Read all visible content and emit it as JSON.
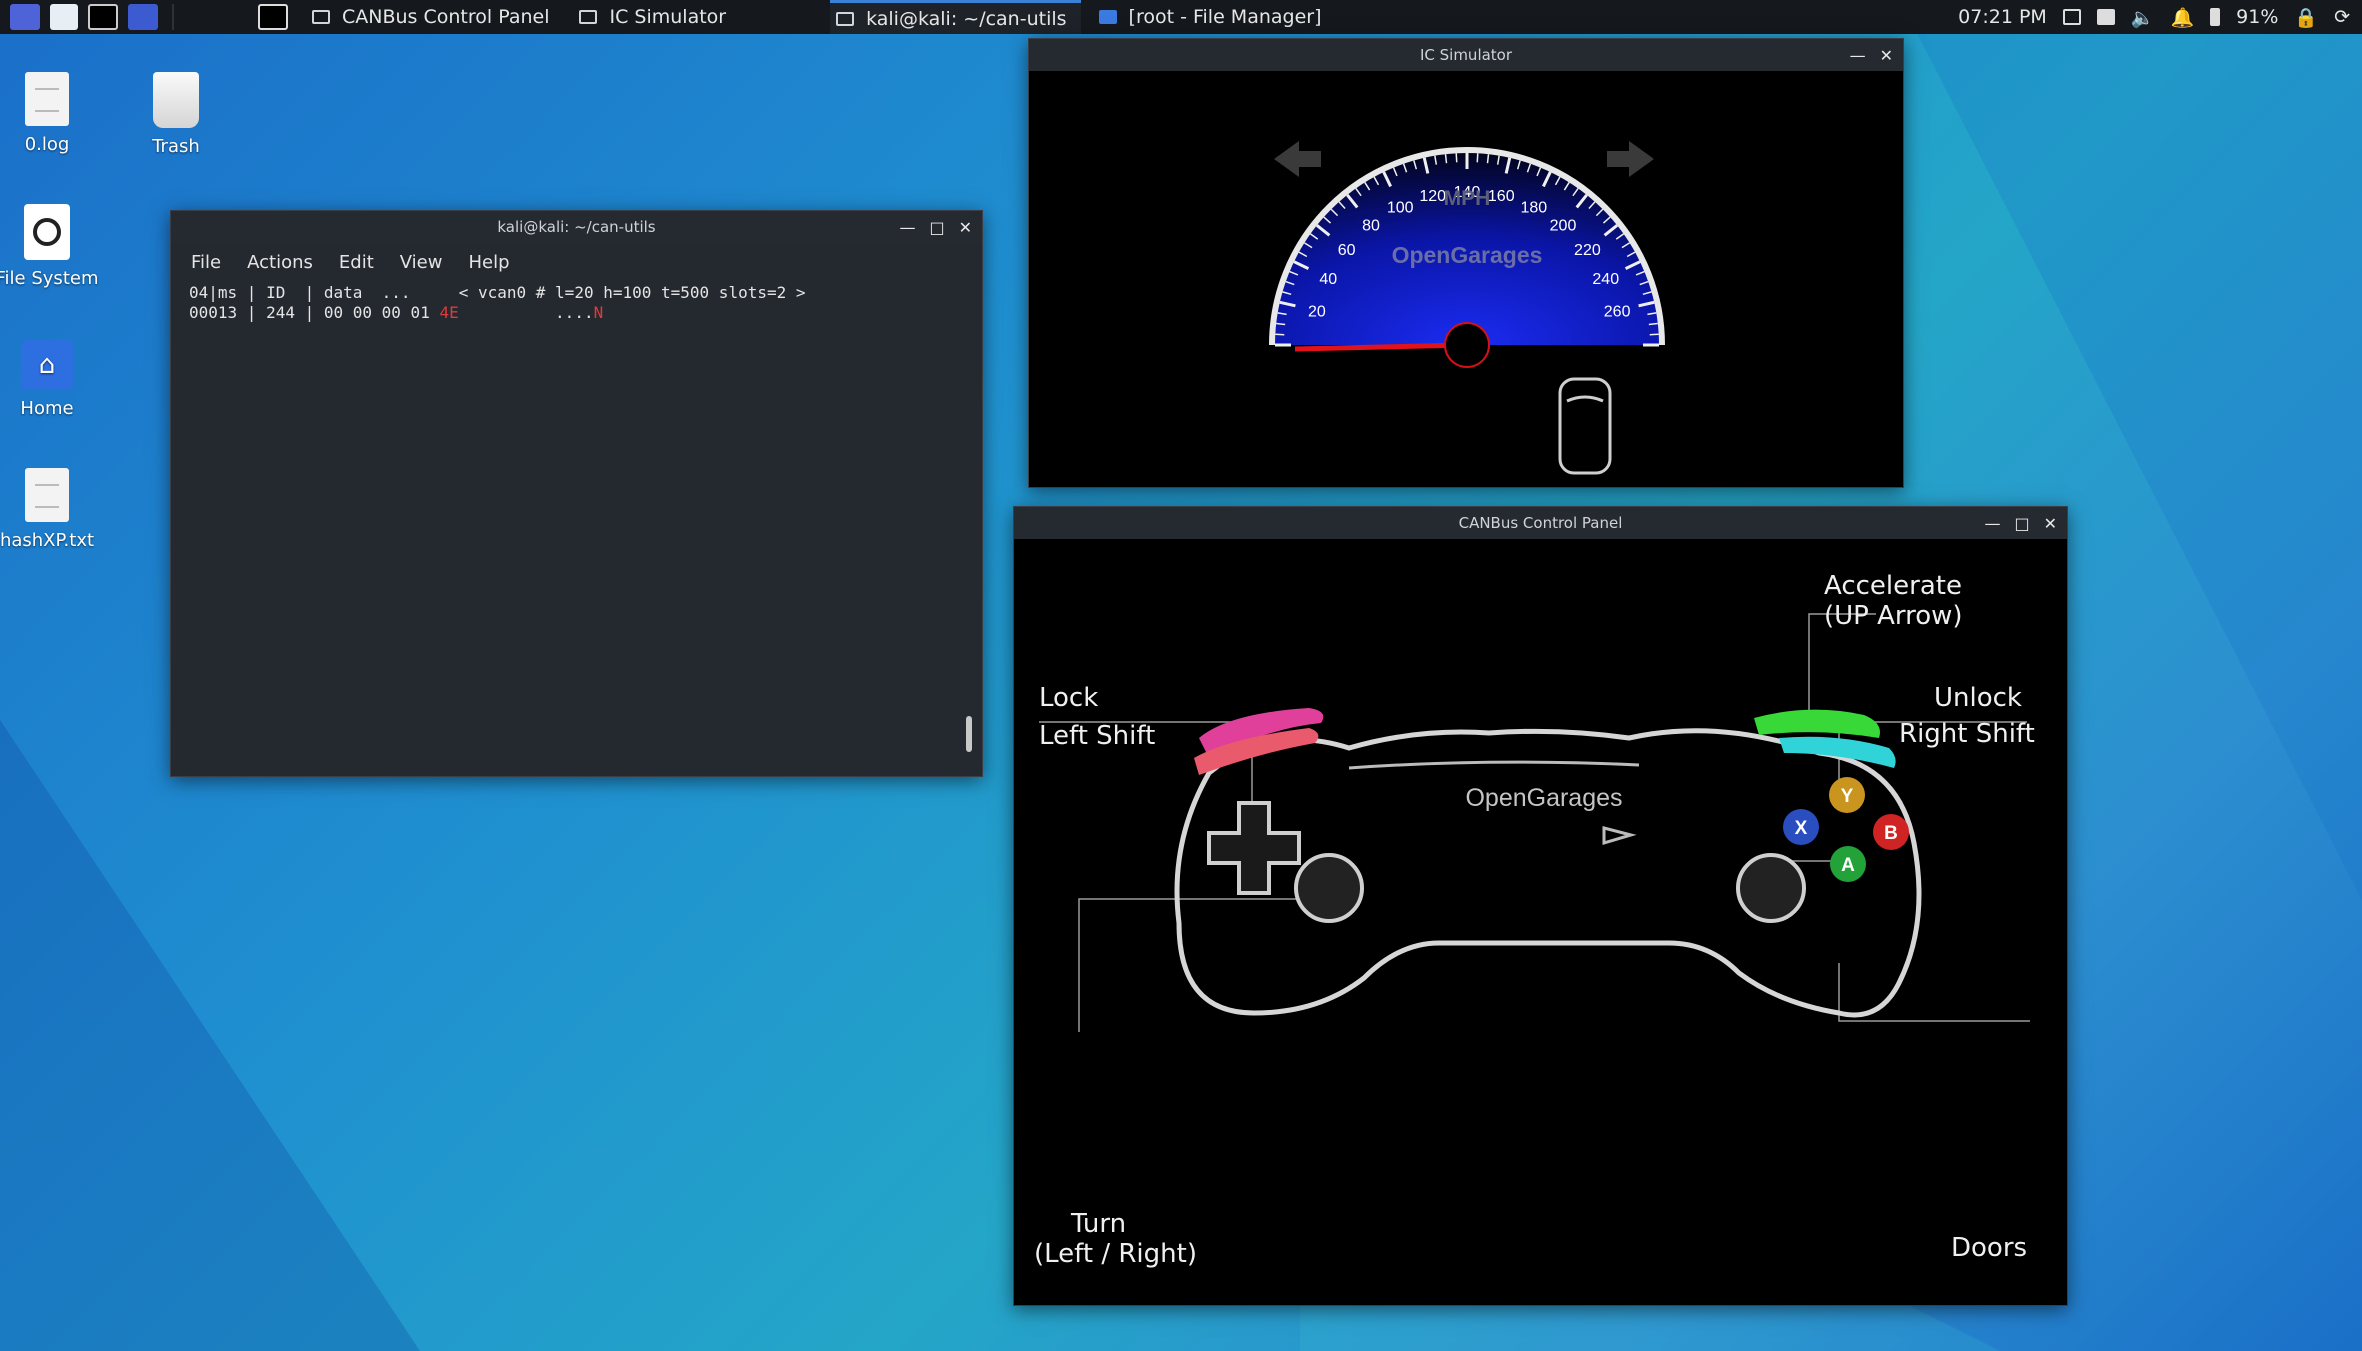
{
  "taskbar": {
    "tasks": [
      {
        "label": "CANBus Control Panel"
      },
      {
        "label": "IC Simulator"
      },
      {
        "label": "kali@kali: ~/can-utils"
      },
      {
        "label": "[root - File Manager]"
      }
    ],
    "clock": "07:21 PM",
    "battery": "91%"
  },
  "desktop": {
    "icons": [
      {
        "label": "0.log"
      },
      {
        "label": "Trash"
      },
      {
        "label": "File System"
      },
      {
        "label": "Home"
      },
      {
        "label": "hashXP.txt"
      }
    ]
  },
  "terminal": {
    "title": "kali@kali: ~/can-utils",
    "menu": [
      "File",
      "Actions",
      "Edit",
      "View",
      "Help"
    ],
    "header_line": "04|ms | ID  | data  ...     < vcan0 # l=20 h=100 t=500 slots=2 >",
    "row_prefix": "00013 | 244 | 00 00 00 01 ",
    "row_hex_highlight": "4E",
    "row_ascii": "          ....",
    "row_ascii_highlight": "N"
  },
  "ic_simulator": {
    "title": "IC Simulator",
    "unit": "MPH",
    "brand": "OpenGarages",
    "ticks": [
      "20",
      "40",
      "60",
      "80",
      "100",
      "120",
      "140",
      "160",
      "180",
      "200",
      "220",
      "240",
      "260"
    ],
    "speed": 0
  },
  "control_panel": {
    "title": "CANBus Control Panel",
    "brand": "OpenGarages",
    "labels": {
      "accelerate": "Accelerate",
      "accelerate_key": "(UP Arrow)",
      "lock": "Lock",
      "lock_key": "Left Shift",
      "unlock": "Unlock",
      "unlock_key": "Right Shift",
      "turn": "Turn",
      "turn_keys": "(Left / Right)",
      "doors": "Doors"
    },
    "buttons": {
      "y": "Y",
      "x": "X",
      "b": "B",
      "a": "A"
    },
    "colors": {
      "lock_bumper": "#e0409a",
      "unlock_bumper": "#2fd3d8",
      "accelerate_trigger": "#39d839",
      "y": "#c9951e",
      "x": "#2a4dbf",
      "b": "#d02424",
      "a": "#23a23a"
    }
  }
}
